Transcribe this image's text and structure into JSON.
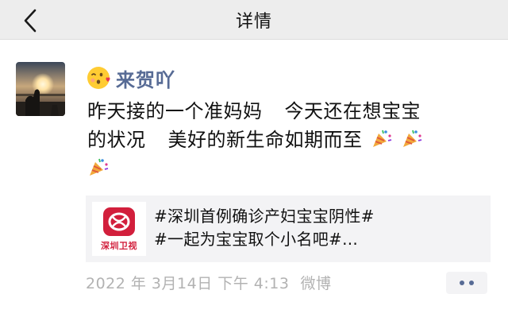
{
  "navbar": {
    "title": "详情",
    "back_icon": "chevron-left-icon"
  },
  "post": {
    "author": {
      "name": "来贺吖",
      "emoji_icon": "kissing-heart-emoji-icon",
      "name_color": "#576b95"
    },
    "avatar_icon": "sunset-photo-avatar",
    "text_lines": [
      {
        "parts": [
          "昨天接的一个准妈妈",
          "今天还在想宝宝"
        ]
      },
      {
        "parts": [
          "的状况",
          "美好的新生命如期而至"
        ],
        "trailing_icons": [
          "party-popper-icon",
          "party-popper-icon"
        ]
      },
      {
        "parts": [],
        "trailing_icons": [
          "party-popper-icon"
        ]
      }
    ],
    "shared_card": {
      "logo_text": "深圳卫视",
      "logo_icon": "shenzhen-tv-logo-icon",
      "title_lines": [
        "#深圳首例确诊产妇宝宝阴性#",
        "#一起为宝宝取个小名吧#..."
      ]
    },
    "meta": {
      "timestamp": "2022 年 3月14日 下午 4:13",
      "source": "微博"
    },
    "more_icon": "more-dots-icon"
  },
  "colors": {
    "nav_background": "#ededed",
    "link_blue": "#576b95",
    "meta_gray": "#b2b2b2",
    "card_background": "#f3f3f5",
    "logo_red": "#d21f3c"
  }
}
